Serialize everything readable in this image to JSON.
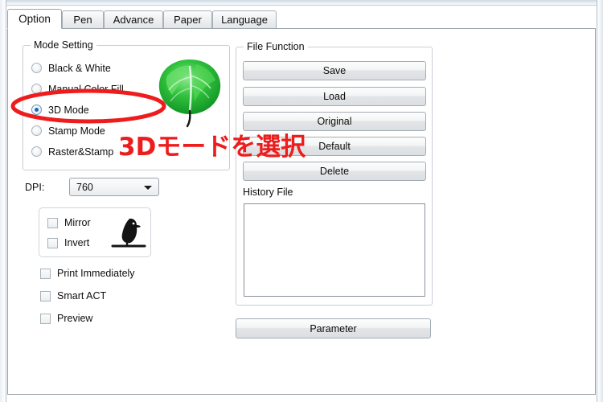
{
  "window": {
    "tabs": [
      {
        "label": "Option",
        "active": true
      },
      {
        "label": "Pen",
        "active": false
      },
      {
        "label": "Advance",
        "active": false
      },
      {
        "label": "Paper",
        "active": false
      },
      {
        "label": "Language",
        "active": false
      }
    ]
  },
  "mode_setting": {
    "title": "Mode Setting",
    "options": [
      {
        "label": "Black & White",
        "selected": false
      },
      {
        "label": "Manual Color Fill",
        "selected": false
      },
      {
        "label": "3D Mode",
        "selected": true
      },
      {
        "label": "Stamp Mode",
        "selected": false
      },
      {
        "label": "Raster&Stamp",
        "selected": false
      }
    ]
  },
  "file_function": {
    "title": "File Function",
    "buttons": [
      {
        "label": "Save"
      },
      {
        "label": "Load"
      },
      {
        "label": "Original"
      },
      {
        "label": "Default"
      },
      {
        "label": "Delete"
      }
    ],
    "history": {
      "label": "History File",
      "items": []
    }
  },
  "dpi": {
    "label": "DPI:",
    "value": "760",
    "options": [
      "760"
    ]
  },
  "checkboxes": [
    {
      "label": "Mirror",
      "checked": false
    },
    {
      "label": "Invert",
      "checked": false
    },
    {
      "label": "Print Immediately",
      "checked": false
    },
    {
      "label": "Smart ACT",
      "checked": false
    },
    {
      "label": "Preview",
      "checked": false
    }
  ],
  "parameter_button": {
    "label": "Parameter"
  },
  "annotations": {
    "text": "3Dモードを選択",
    "color": "#ee1c1c",
    "ellipse_target": "3D Mode"
  },
  "images": {
    "leaf": "green-leaf-preview",
    "bird": "black-bird-silhouette"
  }
}
